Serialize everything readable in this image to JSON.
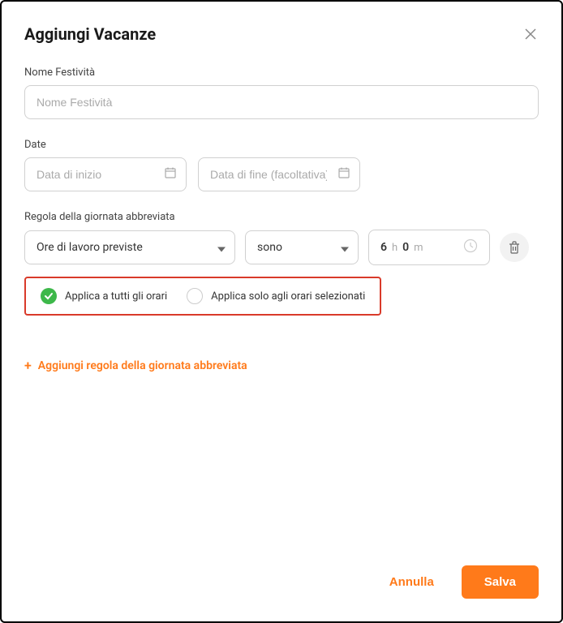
{
  "modal": {
    "title": "Aggiungi Vacanze"
  },
  "name_field": {
    "label": "Nome Festività",
    "placeholder": "Nome Festività",
    "value": ""
  },
  "date_field": {
    "label": "Date",
    "start_placeholder": "Data di inizio",
    "end_placeholder": "Data di fine (facoltativa)",
    "start_value": "",
    "end_value": ""
  },
  "rule": {
    "label": "Regola della giornata abbreviata",
    "select1": "Ore di lavoro previste",
    "select2": "sono",
    "hours": "6",
    "hours_unit": "h",
    "minutes": "0",
    "minutes_unit": "m"
  },
  "apply_options": {
    "all": "Applica a tutti gli orari",
    "selected": "Applica solo agli orari selezionati"
  },
  "add_rule_label": "Aggiungi regola della giornata abbreviata",
  "footer": {
    "cancel": "Annulla",
    "save": "Salva"
  }
}
